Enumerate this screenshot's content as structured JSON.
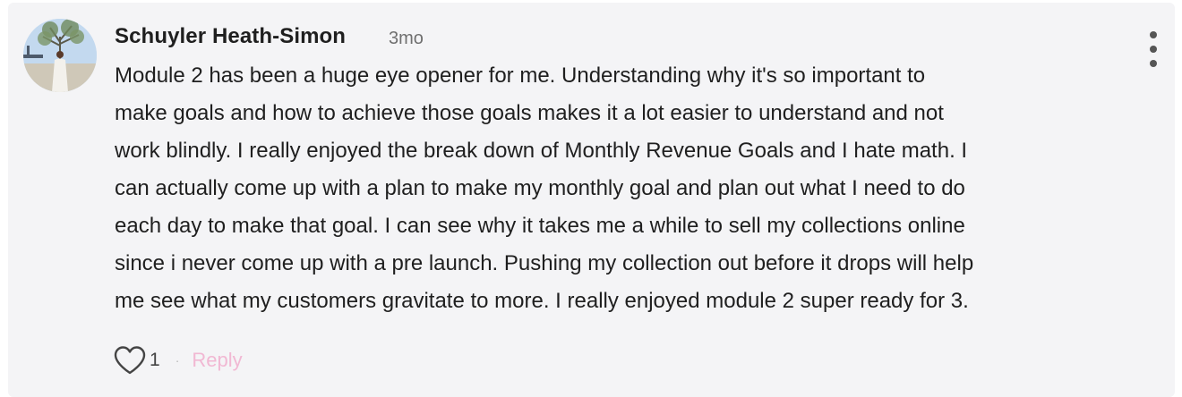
{
  "comment": {
    "author": "Schuyler Heath-Simon",
    "timestamp": "3mo",
    "lines": [
      "Module 2 has been a huge eye opener for me. Understanding why it's so important to",
      "make goals and how to achieve those goals makes it a lot easier to understand and not",
      "work blindly. I really enjoyed the break down of Monthly Revenue Goals and I hate math. I",
      "can actually come up with a plan to make my monthly goal and plan out what I need to do",
      "each day to make that goal. I can see why it takes me a while to sell my collections online",
      "since i never come up with a pre launch. Pushing my collection out before it drops will help",
      "me see what my customers gravitate to more. I really enjoyed module 2 super ready for 3."
    ],
    "like_count": "1",
    "separator": "·",
    "reply_label": "Reply"
  },
  "icons": {
    "like": "heart-outline-icon",
    "menu": "more-vertical-icon"
  },
  "colors": {
    "card_background": "#f4f4f6",
    "reply_link": "#f1b8d3",
    "text": "#1f1f1f",
    "timestamp": "#6f6f6f"
  }
}
